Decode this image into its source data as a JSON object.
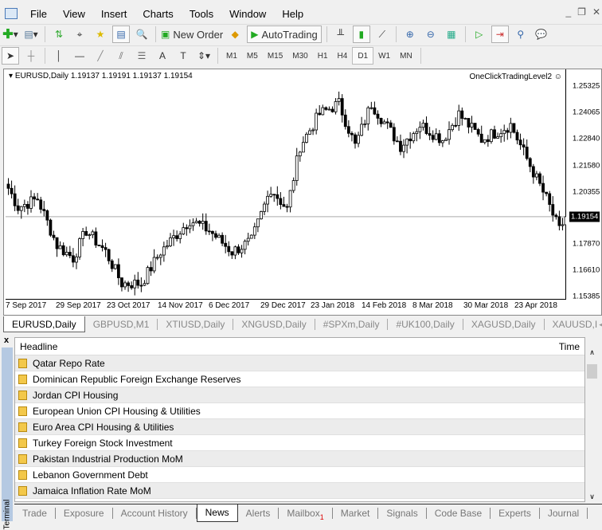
{
  "menu": [
    "File",
    "View",
    "Insert",
    "Charts",
    "Tools",
    "Window",
    "Help"
  ],
  "toolbar": {
    "new_order": "New Order",
    "autotrading": "AutoTrading"
  },
  "timeframes": [
    "M1",
    "M5",
    "M15",
    "M30",
    "H1",
    "H4",
    "D1",
    "W1",
    "MN"
  ],
  "active_timeframe": "D1",
  "chart": {
    "symbol_line": "EURUSD,Daily  1.19137 1.19191 1.19137 1.19154",
    "expert": "OneClickTradingLevel2 ☺"
  },
  "chart_data": {
    "type": "candlestick",
    "symbol": "EURUSD",
    "period": "Daily",
    "ohlc_last": [
      1.19137,
      1.19191,
      1.19137,
      1.19154
    ],
    "current_price": "1.19154",
    "price_ticks": [
      "1.25325",
      "1.24065",
      "1.22840",
      "1.21580",
      "1.20355",
      "1.17870",
      "1.16610",
      "1.15385"
    ],
    "price_range": [
      1.15385,
      1.25325
    ],
    "date_ticks": [
      "7 Sep 2017",
      "29 Sep 2017",
      "23 Oct 2017",
      "14 Nov 2017",
      "6 Dec 2017",
      "29 Dec 2017",
      "23 Jan 2018",
      "14 Feb 2018",
      "8 Mar 2018",
      "30 Mar 2018",
      "23 Apr 2018"
    ],
    "close_anchors": [
      [
        0,
        1.205
      ],
      [
        3,
        1.196
      ],
      [
        9,
        1.2
      ],
      [
        15,
        1.178
      ],
      [
        20,
        1.172
      ],
      [
        24,
        1.185
      ],
      [
        30,
        1.175
      ],
      [
        35,
        1.16
      ],
      [
        41,
        1.16
      ],
      [
        47,
        1.175
      ],
      [
        56,
        1.19
      ],
      [
        62,
        1.185
      ],
      [
        69,
        1.175
      ],
      [
        75,
        1.18
      ],
      [
        81,
        1.205
      ],
      [
        86,
        1.195
      ],
      [
        90,
        1.225
      ],
      [
        96,
        1.24
      ],
      [
        102,
        1.245
      ],
      [
        107,
        1.225
      ],
      [
        112,
        1.245
      ],
      [
        121,
        1.225
      ],
      [
        127,
        1.235
      ],
      [
        134,
        1.228
      ],
      [
        139,
        1.24
      ],
      [
        146,
        1.228
      ],
      [
        155,
        1.235
      ],
      [
        159,
        1.222
      ],
      [
        166,
        1.2
      ],
      [
        170,
        1.185
      ],
      [
        172,
        1.1915
      ]
    ]
  },
  "chart_tabs": [
    "EURUSD,Daily",
    "GBPUSD,M1",
    "XTIUSD,Daily",
    "XNGUSD,Daily",
    "#SPXm,Daily",
    "#UK100,Daily",
    "XAGUSD,Daily",
    "XAUUSD,I"
  ],
  "terminal": {
    "side_label": "Terminal",
    "columns": {
      "headline": "Headline",
      "time": "Time"
    },
    "news": [
      "Qatar Repo Rate",
      "Dominican Republic Foreign Exchange Reserves",
      "Jordan CPI Housing",
      "European Union CPI Housing & Utilities",
      "Euro Area CPI Housing & Utilities",
      "Turkey Foreign Stock Investment",
      "Pakistan Industrial Production MoM",
      "Lebanon Government Debt",
      "Jamaica Inflation Rate MoM"
    ],
    "tabs": [
      "Trade",
      "Exposure",
      "Account History",
      "News",
      "Alerts",
      "Mailbox",
      "Market",
      "Signals",
      "Code Base",
      "Experts",
      "Journal"
    ],
    "active_tab": "News",
    "mailbox_badge": "1"
  }
}
